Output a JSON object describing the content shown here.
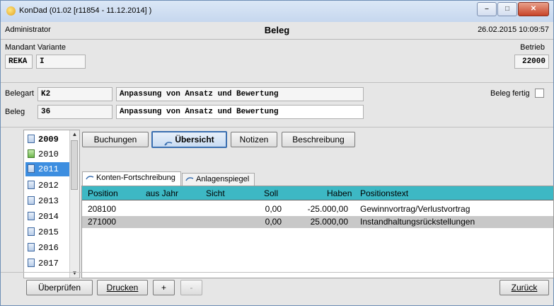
{
  "window": {
    "title": "KonDad (01.02 [r11854 - 11.12.2014] )"
  },
  "header": {
    "user": "Administrator",
    "title": "Beleg",
    "datetime": "26.02.2015 10:09:57"
  },
  "mandant": {
    "label": "Mandant Variante",
    "mandant_value": "REKA",
    "variante_value": "I",
    "betrieb_label": "Betrieb",
    "betrieb_value": "22000"
  },
  "beleg": {
    "belegart_label": "Belegart",
    "belegart_code": "K2",
    "belegart_text": "Anpassung von Ansatz und Bewertung",
    "beleg_label": "Beleg",
    "beleg_number": "36",
    "beleg_text": "Anpassung von Ansatz und Bewertung",
    "beleg_fertig_label": "Beleg fertig",
    "beleg_fertig_checked": false
  },
  "years": {
    "items": [
      {
        "label": "2009",
        "bold": true,
        "icon": "document-icon",
        "selected": false
      },
      {
        "label": "2010",
        "bold": false,
        "icon": "document-check-icon",
        "selected": false
      },
      {
        "label": "2011",
        "bold": false,
        "icon": "document-icon",
        "selected": true
      },
      {
        "label": "2012",
        "bold": false,
        "icon": "document-icon",
        "selected": false
      },
      {
        "label": "2013",
        "bold": false,
        "icon": "document-icon",
        "selected": false
      },
      {
        "label": "2014",
        "bold": false,
        "icon": "document-icon",
        "selected": false
      },
      {
        "label": "2015",
        "bold": false,
        "icon": "document-icon",
        "selected": false
      },
      {
        "label": "2016",
        "bold": false,
        "icon": "document-icon",
        "selected": false
      },
      {
        "label": "2017",
        "bold": false,
        "icon": "document-icon",
        "selected": false
      }
    ]
  },
  "tabs": {
    "buchungen": "Buchungen",
    "uebersicht": "Übersicht",
    "notizen": "Notizen",
    "beschreibung": "Beschreibung",
    "active": "uebersicht"
  },
  "subtabs": {
    "konten": "Konten-Fortschreibung",
    "anlagen": "Anlagenspiegel",
    "active": "konten"
  },
  "table": {
    "columns": [
      "Position",
      "aus Jahr",
      "Sicht",
      "Soll",
      "Haben",
      "Positionstext"
    ],
    "rows": [
      {
        "position": "208100",
        "aus_jahr": "",
        "sicht": "",
        "soll": "0,00",
        "haben": "-25.000,00",
        "text": "Gewinnvortrag/Verlustvortrag"
      },
      {
        "position": "271000",
        "aus_jahr": "",
        "sicht": "",
        "soll": "0,00",
        "haben": "25.000,00",
        "text": "Instandhaltungsrückstellungen"
      }
    ]
  },
  "footer": {
    "ueberpruefen": "Überprüfen",
    "drucken": "Drucken",
    "plus": "+",
    "minus": "-",
    "zurueck": "Zurück"
  },
  "colors": {
    "table_header": "#3db8c4",
    "selection": "#3d8ee0"
  }
}
